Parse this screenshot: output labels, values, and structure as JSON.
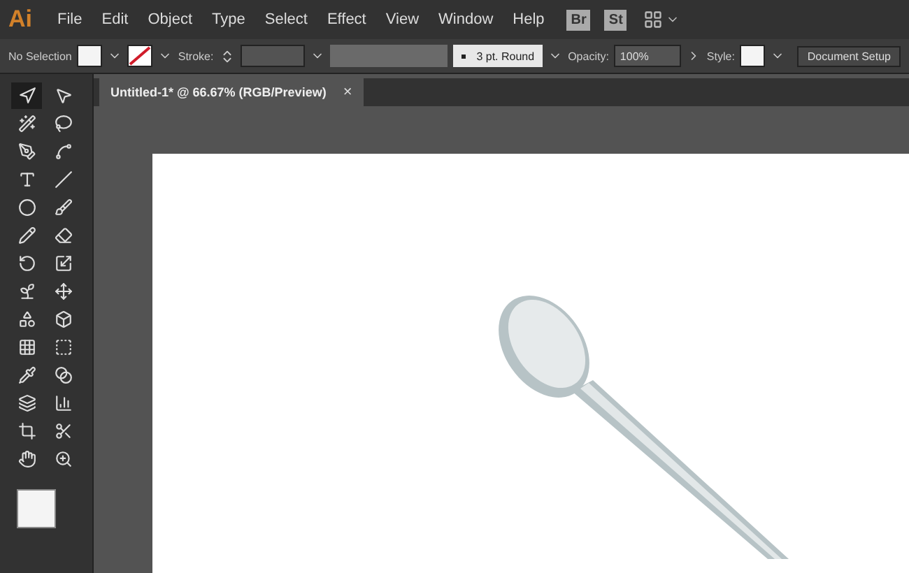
{
  "app": {
    "logo": "Ai"
  },
  "menu": [
    "File",
    "Edit",
    "Object",
    "Type",
    "Select",
    "Effect",
    "View",
    "Window",
    "Help"
  ],
  "app_buttons": [
    "Br",
    "St"
  ],
  "control_bar": {
    "selection": "No Selection",
    "stroke_label": "Stroke:",
    "brush": "3 pt. Round",
    "opacity_label": "Opacity:",
    "opacity": "100%",
    "style_label": "Style:",
    "document_setup": "Document Setup"
  },
  "tools": [
    {
      "kind": "selection",
      "selected": true
    },
    {
      "kind": "direct",
      "selected": false
    },
    {
      "kind": "wand",
      "selected": false
    },
    {
      "kind": "lasso",
      "selected": false
    },
    {
      "kind": "pen",
      "selected": false
    },
    {
      "kind": "curvature",
      "selected": false
    },
    {
      "kind": "type",
      "selected": false
    },
    {
      "kind": "line",
      "selected": false
    },
    {
      "kind": "ellipse",
      "selected": false
    },
    {
      "kind": "brush",
      "selected": false
    },
    {
      "kind": "shaper",
      "selected": false
    },
    {
      "kind": "eraser",
      "selected": false
    },
    {
      "kind": "rotate",
      "selected": false
    },
    {
      "kind": "scale",
      "selected": false
    },
    {
      "kind": "warp",
      "selected": false
    },
    {
      "kind": "freetransform",
      "selected": false
    },
    {
      "kind": "shapebuilder",
      "selected": false
    },
    {
      "kind": "perspective",
      "selected": false
    },
    {
      "kind": "mesh",
      "selected": false
    },
    {
      "kind": "gradient",
      "selected": false
    },
    {
      "kind": "eyedropper",
      "selected": false
    },
    {
      "kind": "blend",
      "selected": false
    },
    {
      "kind": "symbol",
      "selected": false
    },
    {
      "kind": "graph",
      "selected": false
    },
    {
      "kind": "artboard",
      "selected": false
    },
    {
      "kind": "slice",
      "selected": false
    },
    {
      "kind": "hand",
      "selected": false
    },
    {
      "kind": "zoom",
      "selected": false
    }
  ],
  "document_tab": {
    "title": "Untitled-1* @ 66.67% (RGB/Preview)",
    "close": "×"
  }
}
